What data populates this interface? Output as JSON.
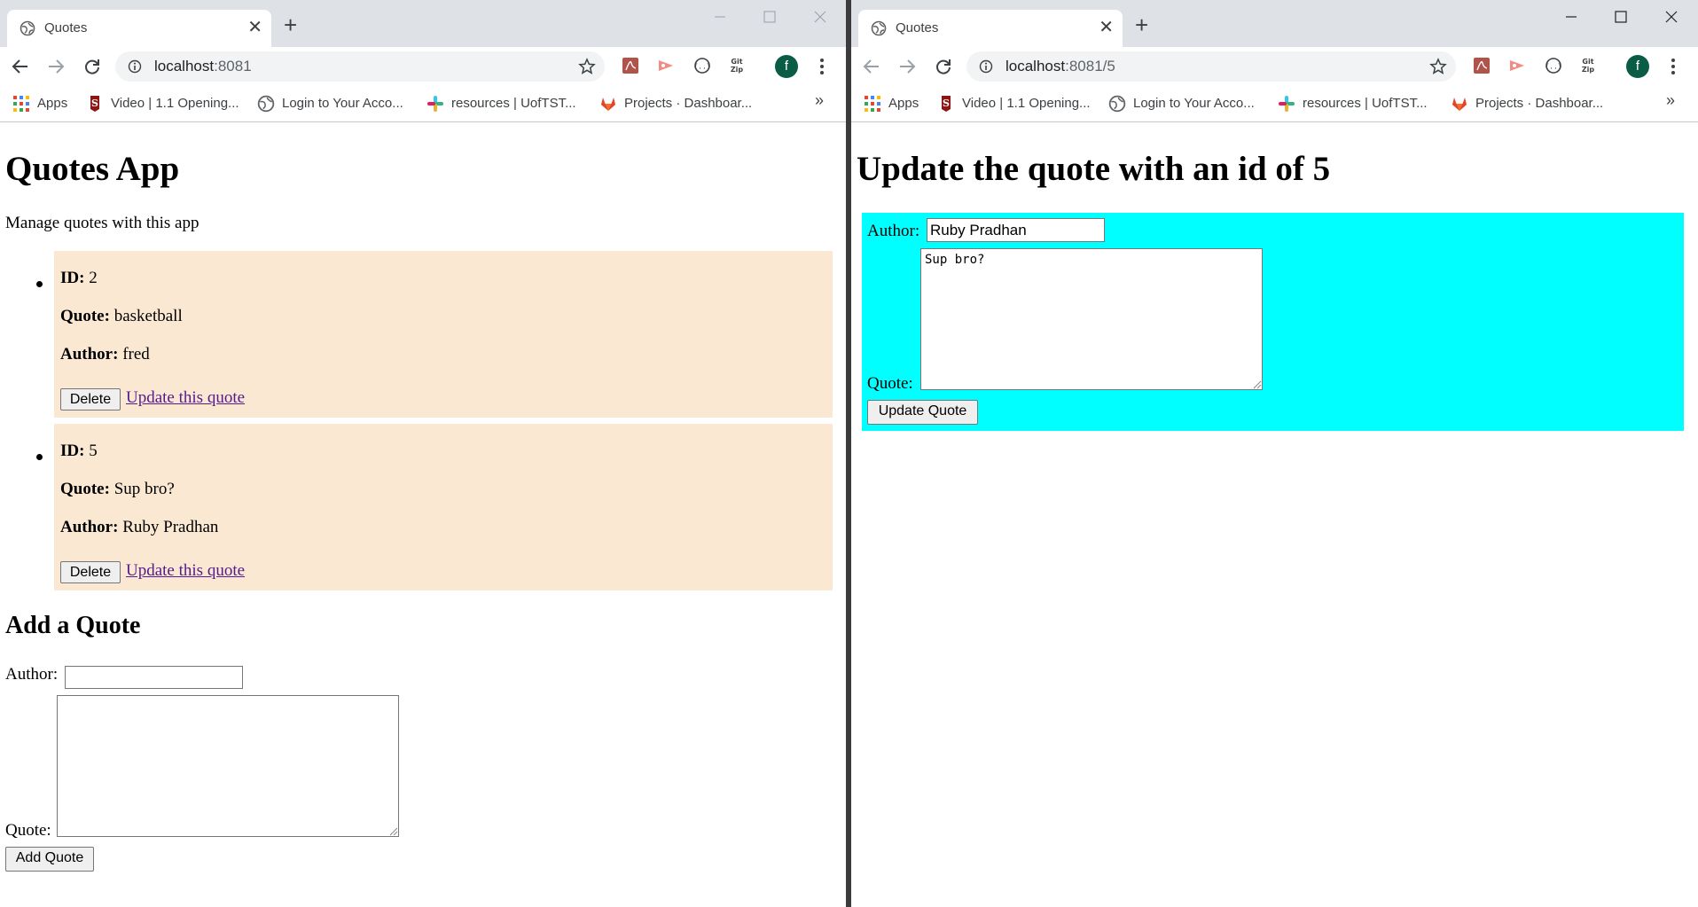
{
  "browser": {
    "tab_title": "Quotes",
    "bookmarks": [
      {
        "label": "Apps",
        "icon": "apps-grid-icon"
      },
      {
        "label": "Video | 1.1 Opening...",
        "icon": "stanford-logo-icon"
      },
      {
        "label": "Login to Your Acco...",
        "icon": "globe-icon"
      },
      {
        "label": "resources | UofTST...",
        "icon": "slack-icon"
      },
      {
        "label": "Projects · Dashboar...",
        "icon": "gitlab-icon"
      }
    ],
    "more_bookmarks": "»",
    "profile_initial": "f",
    "extensions": [
      "pdf-icon",
      "screencast-icon",
      "json-viewer-icon",
      "gitzip-icon"
    ],
    "colors": {
      "titlebar": "#dee1e6",
      "omnibox": "#f1f3f4",
      "avatar": "#0b5c44"
    }
  },
  "left": {
    "url_host": "localhost",
    "url_rest": ":8081",
    "page": {
      "title": "Quotes App",
      "subtitle": "Manage quotes with this app",
      "labels": {
        "id": "ID:",
        "quote": "Quote:",
        "author": "Author:"
      },
      "quotes": [
        {
          "id": "2",
          "quote": "basketball",
          "author": "fred",
          "delete_label": "Delete",
          "update_link": "Update this quote"
        },
        {
          "id": "5",
          "quote": "Sup bro?",
          "author": "Ruby Pradhan",
          "delete_label": "Delete",
          "update_link": "Update this quote"
        }
      ],
      "add_heading": "Add a Quote",
      "author_label": "Author:",
      "quote_label": "Quote:",
      "author_value": "",
      "quote_value": "",
      "add_button": "Add Quote",
      "card_color": "#fae8d3"
    }
  },
  "right": {
    "url_host": "localhost",
    "url_rest": ":8081/5",
    "page": {
      "title": "Update the quote with an id of 5",
      "author_label": "Author:",
      "author_value": "Ruby Pradhan",
      "quote_label": "Quote:",
      "quote_value": "Sup bro?",
      "submit_button": "Update Quote",
      "form_color": "#00ffff"
    }
  }
}
